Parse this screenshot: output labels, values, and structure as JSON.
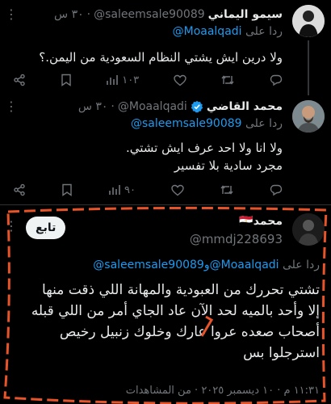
{
  "tweets": [
    {
      "name": "سيمو اليماني",
      "handle": "@saleemsale90089",
      "dot": "·",
      "time": "٣٠ س",
      "replying_prefix": "ردا على",
      "replying_to": "@Moaalqadi",
      "text": "ولا درين ايش يشتي النظام السعودية من اليمن.؟",
      "views": "١٠٣",
      "likes": "",
      "retweets": "",
      "replies": ""
    },
    {
      "name": "محمد القاضي",
      "handle": "@Moaalqadi",
      "dot": "·",
      "time": "٣٠ س",
      "replying_prefix": "ردا على",
      "replying_to": "@saleemsale90089",
      "text_line1": "ولا انا ولا احد عرف ايش تشتي.",
      "text_line2": "مجرد سادية بلا تفسير",
      "views": "٩٠"
    },
    {
      "name": "محمد🇪🇬",
      "handle": "@mmdj228693",
      "follow_label": "تابع",
      "replying_prefix": "ردا على",
      "replying_to_1": "@Moaalqadi",
      "replying_conj": "و",
      "replying_to_2": "@saleemsale90089",
      "text_lines": [
        "تشتي تحررك من العبودية والمهانة اللي ذقت منها",
        "إلا وأحد بالميه لحد الآن عاد الجاي أمر من اللي قبله",
        "أصحاب صعده عروا عارك وخلوك زنبيل رخيص",
        "استرجلوا بس"
      ],
      "footer": "١١:٣١ م · ١٠ ديسمبر ٢٠٢٥ · من المشاهدات"
    }
  ],
  "colors": {
    "accent": "#1d9bf0",
    "highlight": "#e8542a",
    "verified": "#1d9bf0"
  }
}
